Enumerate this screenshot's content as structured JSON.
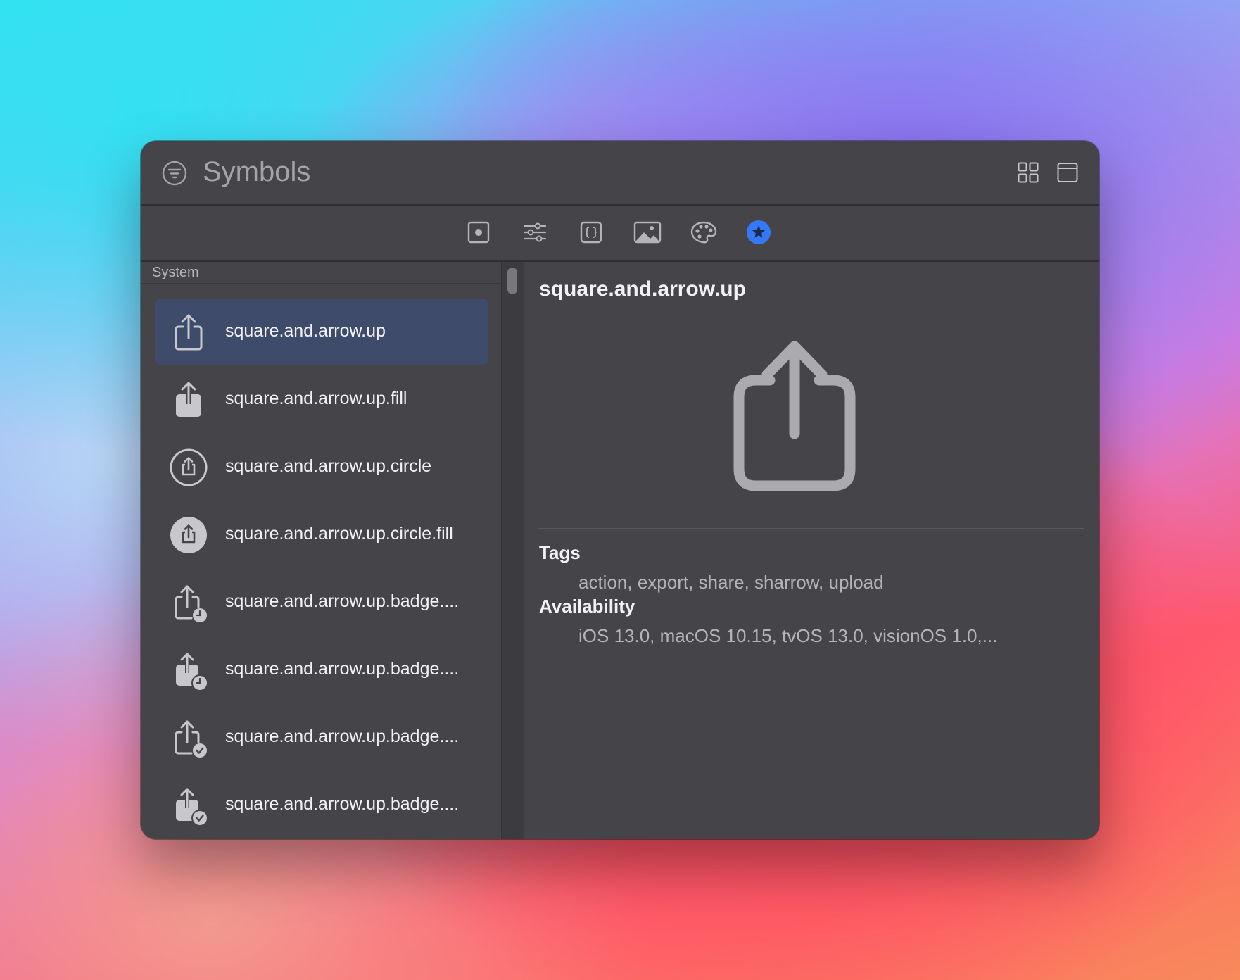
{
  "window": {
    "title": "Symbols"
  },
  "toolbar": {
    "tools": [
      "record-icon",
      "sliders-icon",
      "braces-icon",
      "image-icon",
      "palette-icon",
      "star-circle-icon"
    ],
    "active_tool": "star-circle-icon",
    "accent_color": "#3478f6"
  },
  "sidebar": {
    "section": "System",
    "items": [
      {
        "label": "square.and.arrow.up",
        "icon": "share-icon",
        "selected": true
      },
      {
        "label": "square.and.arrow.up.fill",
        "icon": "share-fill-icon"
      },
      {
        "label": "square.and.arrow.up.circle",
        "icon": "share-circle-icon"
      },
      {
        "label": "square.and.arrow.up.circle.fill",
        "icon": "share-circle-fill-icon"
      },
      {
        "label": "square.and.arrow.up.badge....",
        "icon": "share-badge-clock-icon"
      },
      {
        "label": "square.and.arrow.up.badge....",
        "icon": "share-fill-badge-clock-icon"
      },
      {
        "label": "square.and.arrow.up.badge....",
        "icon": "share-badge-check-icon"
      },
      {
        "label": "square.and.arrow.up.badge....",
        "icon": "share-fill-badge-check-icon"
      }
    ],
    "selected_color": "#3e4b6b"
  },
  "detail": {
    "title": "square.and.arrow.up",
    "preview_icon": "share-icon",
    "tags_heading": "Tags",
    "tags": "action, export, share, sharrow, upload",
    "availability_heading": "Availability",
    "availability": "iOS 13.0, macOS 10.15, tvOS 13.0, visionOS 1.0,..."
  }
}
